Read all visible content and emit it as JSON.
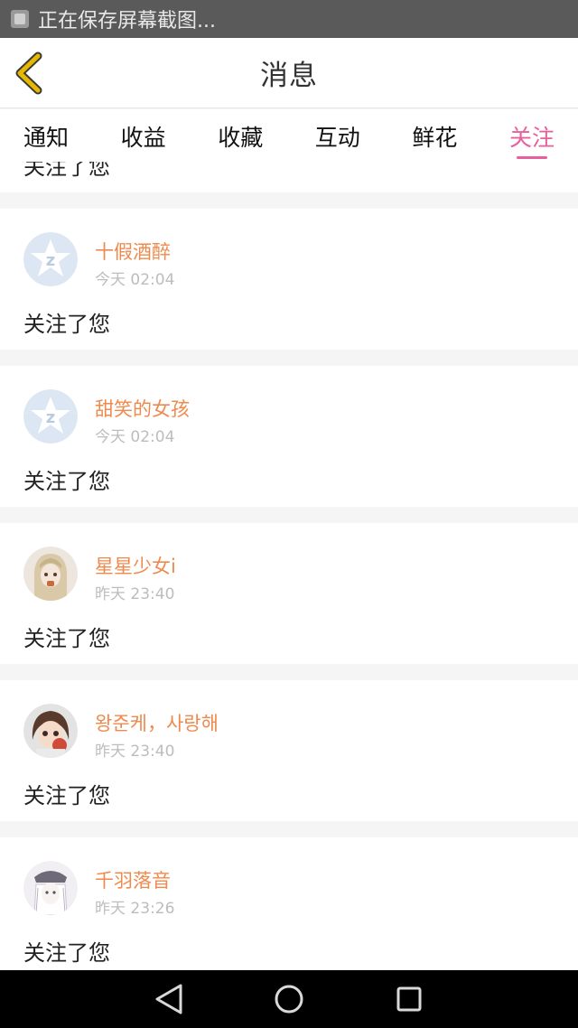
{
  "status_bar": {
    "text": "正在保存屏幕截图..."
  },
  "header": {
    "title": "消息"
  },
  "tabs": [
    {
      "label": "通知",
      "active": false
    },
    {
      "label": "收益",
      "active": false
    },
    {
      "label": "收藏",
      "active": false
    },
    {
      "label": "互动",
      "active": false
    },
    {
      "label": "鲜花",
      "active": false
    },
    {
      "label": "关注",
      "active": true
    }
  ],
  "partial_item": {
    "message": "关注了您"
  },
  "items": [
    {
      "name": "十假酒醉",
      "time": "今天 02:04",
      "message": "关注了您",
      "avatar": "default-star-avatar"
    },
    {
      "name": "甜笑的女孩",
      "time": "今天 02:04",
      "message": "关注了您",
      "avatar": "default-star-avatar"
    },
    {
      "name": "星星少女i",
      "time": "昨天 23:40",
      "message": "关注了您",
      "avatar": "user-photo-avatar"
    },
    {
      "name": "왕준케，사랑해",
      "time": "昨天 23:40",
      "message": "关注了您",
      "avatar": "user-photo-avatar"
    },
    {
      "name": "千羽落音",
      "time": "昨天 23:26",
      "message": "关注了您",
      "avatar": "user-photo-avatar"
    }
  ],
  "colors": {
    "accent": "#e8609b",
    "username": "#ef8a4e",
    "back_icon": "#e6b800"
  }
}
